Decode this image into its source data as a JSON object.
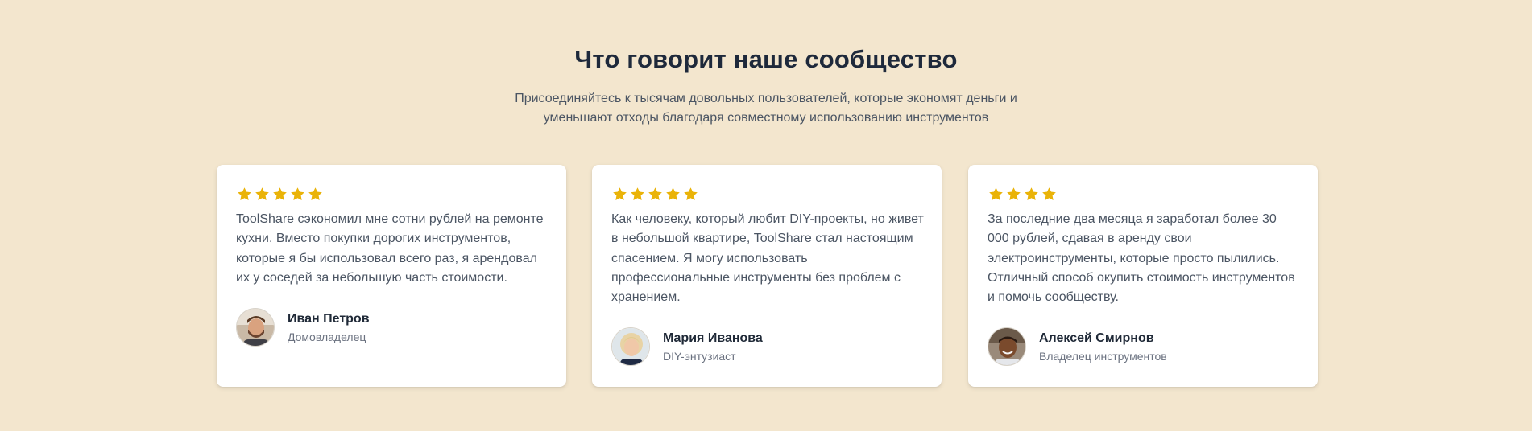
{
  "section": {
    "title": "Что говорит наше сообщество",
    "subtitle": "Присоединяйтесь к тысячам довольных пользователей, которые экономят деньги и уменьшают отходы благодаря совместному использованию инструментов"
  },
  "colors": {
    "background": "#f3e6ce",
    "star": "#eab308",
    "card": "#ffffff"
  },
  "testimonials": [
    {
      "rating": 5,
      "quote": "ToolShare сэкономил мне сотни рублей на ремонте кухни. Вместо покупки дорогих инструментов, которые я бы использовал всего раз, я арендовал их у соседей за небольшую часть стоимости.",
      "name": "Иван Петров",
      "role": "Домовладелец",
      "avatar": "man-beard-avatar"
    },
    {
      "rating": 5,
      "quote": "Как человеку, который любит DIY-проекты, но живет в небольшой квартире, ToolShare стал настоящим спасением. Я могу использовать профессиональные инструменты без проблем с хранением.",
      "name": "Мария Иванова",
      "role": "DIY-энтузиаст",
      "avatar": "woman-blonde-avatar"
    },
    {
      "rating": 4,
      "quote": "За последние два месяца я заработал более 30 000 рублей, сдавая в аренду свои электроинструменты, которые просто пылились. Отличный способ окупить стоимость инструментов и помочь сообществу.",
      "name": "Алексей Смирнов",
      "role": "Владелец инструментов",
      "avatar": "man-smiling-avatar"
    }
  ]
}
